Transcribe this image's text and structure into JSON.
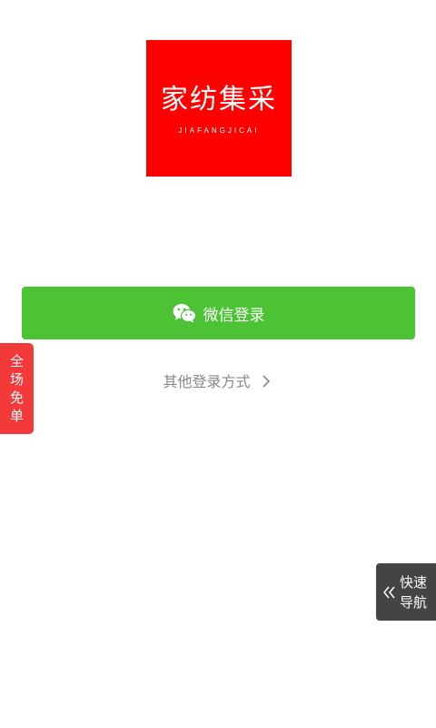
{
  "logo": {
    "name_cn": "家纺集采",
    "name_en": "JIAFANGJICAI",
    "bg_color": "#ff0000"
  },
  "login": {
    "wechat_label": "微信登录",
    "wechat_icon": "wechat-icon",
    "button_color": "#4cc335",
    "other_label": "其他登录方式"
  },
  "badge": {
    "chars": [
      "全",
      "场",
      "免",
      "单"
    ],
    "color": "#f23a3a"
  },
  "quick_nav": {
    "line1": "快速",
    "line2": "导航",
    "icon": "double-chevron-left-icon"
  }
}
